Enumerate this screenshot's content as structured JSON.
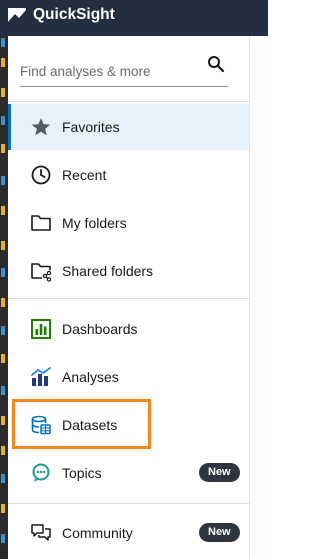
{
  "app": {
    "title": "QuickSight",
    "brand_color": "#232f3e",
    "logo_icon": "quicksight-logo-icon"
  },
  "search": {
    "placeholder": "Find analyses & more",
    "icon": "search-icon"
  },
  "nav": {
    "favorites": {
      "label": "Favorites",
      "icon": "star-icon",
      "active": true
    },
    "recent": {
      "label": "Recent",
      "icon": "clock-icon"
    },
    "my_folders": {
      "label": "My folders",
      "icon": "folder-icon"
    },
    "shared_folders": {
      "label": "Shared folders",
      "icon": "shared-folder-icon"
    },
    "dashboards": {
      "label": "Dashboards",
      "icon": "dashboard-icon"
    },
    "analyses": {
      "label": "Analyses",
      "icon": "analysis-icon"
    },
    "datasets": {
      "label": "Datasets",
      "icon": "database-icon",
      "highlighted": true
    },
    "topics": {
      "label": "Topics",
      "icon": "topics-icon",
      "badge": "New"
    },
    "community": {
      "label": "Community",
      "icon": "community-icon",
      "badge": "New"
    }
  },
  "colors": {
    "active_bg": "#e6f2fa",
    "active_border": "#0073bb",
    "highlight": "#f7871f",
    "badge_bg": "#2f3540"
  }
}
